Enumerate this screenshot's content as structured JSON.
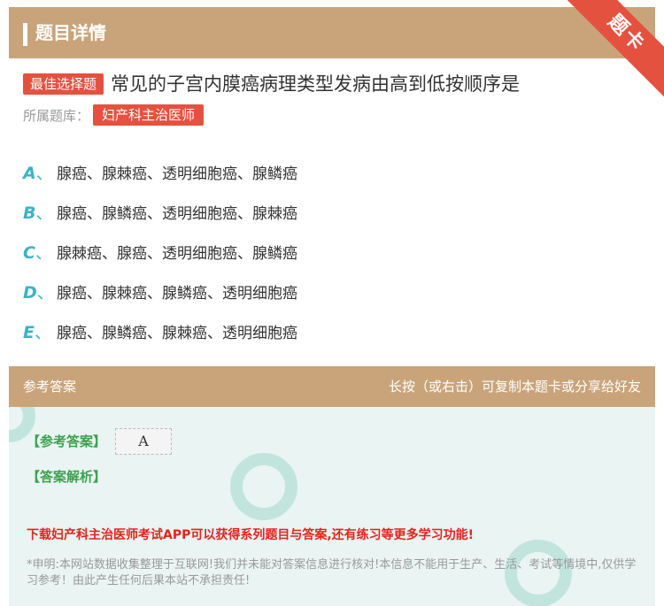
{
  "header": {
    "title": "题目详情",
    "ribbon": "题卡"
  },
  "question": {
    "tag": "最佳选择题",
    "text": "常见的子宫内膜癌病理类型发病由高到低按顺序是",
    "source_label": "所属题库：",
    "source": "妇产科主治医师"
  },
  "options": [
    {
      "letter": "A",
      "sep": "、",
      "text": "腺癌、腺棘癌、透明细胞癌、腺鳞癌"
    },
    {
      "letter": "B",
      "sep": "、",
      "text": "腺癌、腺鳞癌、透明细胞癌、腺棘癌"
    },
    {
      "letter": "C",
      "sep": "、",
      "text": "腺棘癌、腺癌、透明细胞癌、腺鳞癌"
    },
    {
      "letter": "D",
      "sep": "、",
      "text": "腺癌、腺棘癌、腺鳞癌、透明细胞癌"
    },
    {
      "letter": "E",
      "sep": "、",
      "text": "腺癌、腺鳞癌、腺棘癌、透明细胞癌"
    }
  ],
  "answer": {
    "head_left": "参考答案",
    "head_right": "长按（或右击）可复制本题卡或分享给好友",
    "ref_label": "【参考答案】",
    "ref_value": "A",
    "analysis_label": "【答案解析】",
    "promo": "下载妇产科主治医师考试APP可以获得系列题目与答案,还有练习等更多学习功能!",
    "disclaimer": "*申明:本网站数据收集整理于互联网!我们并未能对答案信息进行核对!本信息不能用于生产、生活、考试等情境中,仅供学习参考！由此产生任何后果本站不承担责任!"
  },
  "colors": {
    "header_bg": "#c9a47a",
    "accent_red": "#e5513f",
    "option_letter": "#3bb3c3",
    "answer_green": "#3da14e",
    "promo_red": "#e5231d"
  }
}
